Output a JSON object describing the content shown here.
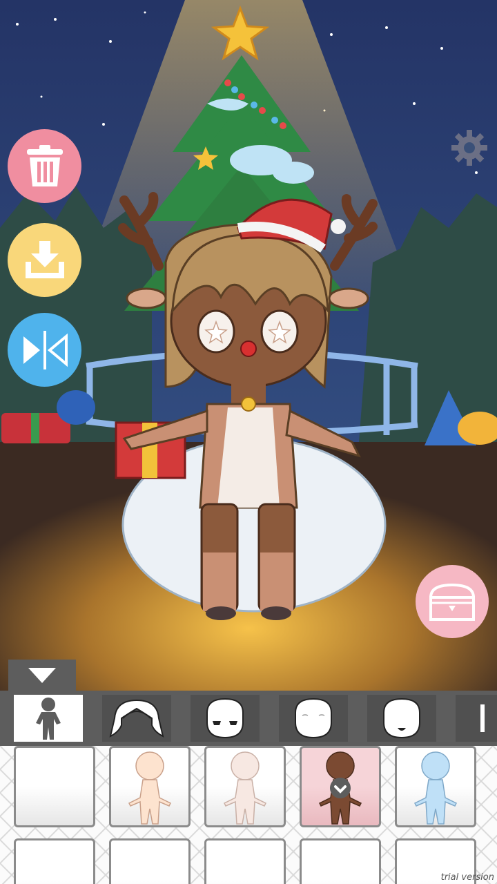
{
  "toolbar": {
    "buttons": [
      {
        "name": "trash-button",
        "icon": "trash-icon",
        "color": "#f08ea0"
      },
      {
        "name": "download-button",
        "icon": "download-icon",
        "color": "#f9d77a"
      },
      {
        "name": "flip-button",
        "icon": "flip-icon",
        "color": "#4fb3ec"
      }
    ]
  },
  "settings": {
    "icon": "gear-icon"
  },
  "chest": {
    "icon": "chest-icon",
    "color": "#f6b8c4"
  },
  "category_tabs": [
    {
      "icon": "body-icon",
      "active": true
    },
    {
      "icon": "hair-icon",
      "active": false
    },
    {
      "icon": "face-eyes-icon",
      "active": false
    },
    {
      "icon": "face-blank-icon",
      "active": false
    },
    {
      "icon": "face-mouth-icon",
      "active": false
    }
  ],
  "body_items": [
    {
      "skin": "none",
      "selected": false
    },
    {
      "skin": "#fde3cf",
      "selected": false
    },
    {
      "skin": "#f7e8e2",
      "selected": false
    },
    {
      "skin": "#7b4a32",
      "selected": true
    },
    {
      "skin": "#bfe0f7",
      "selected": false
    }
  ],
  "watermark": "trial version"
}
